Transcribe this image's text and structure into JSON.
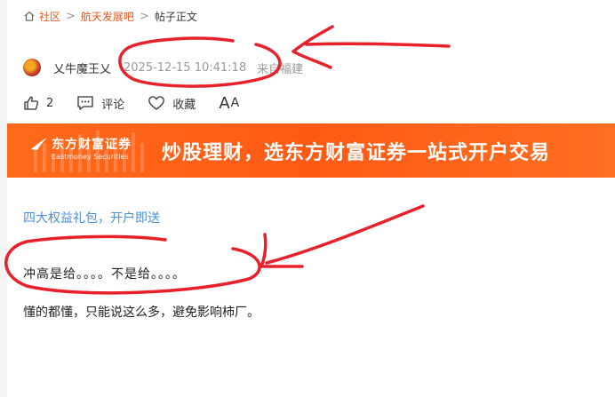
{
  "breadcrumb": {
    "items": [
      "社区",
      "航天发展吧",
      "帖子正文"
    ]
  },
  "post": {
    "author": "乂牛魔王乂",
    "timestamp": "2025-12-15 10:41:18",
    "location": "来自福建"
  },
  "actions": {
    "like_count": "2",
    "comment_label": "评论",
    "favorite_label": "收藏",
    "font_label_big": "A",
    "font_label_small": "A"
  },
  "banner": {
    "brand_cn": "东方财富证券",
    "brand_en": "Eastmoney Securities",
    "slogan": "炒股理财，选东方财富证券一站式开户交易"
  },
  "content": {
    "promo_link": "四大权益礼包，开户即送",
    "paragraphs": [
      "冲高是给。。。。不是给。。。。",
      "懂的都懂，只能说这么多，避免影响柿厂。"
    ]
  },
  "colors": {
    "accent": "#e8561c",
    "link": "#4a90d9",
    "banner": "#ff5a14",
    "annotation": "#e8202a"
  }
}
